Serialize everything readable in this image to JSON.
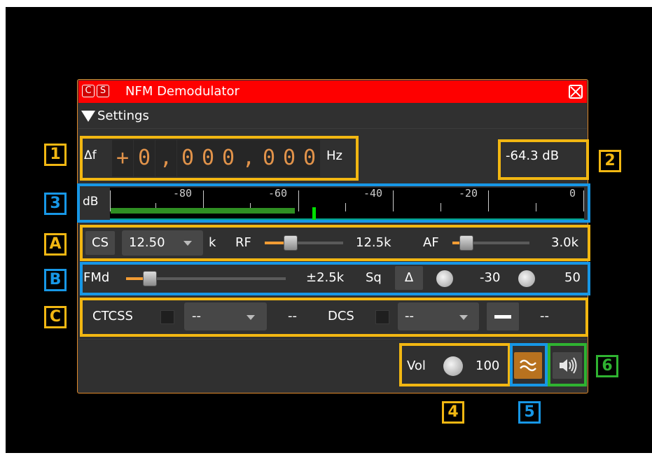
{
  "titlebar": {
    "c_label": "C",
    "s_label": "S",
    "title": "NFM Demodulator"
  },
  "settings": {
    "label": "Settings"
  },
  "frequency": {
    "delta_label": "Δf",
    "sign": "+",
    "digits": [
      "0",
      "0",
      "0",
      "0",
      "0",
      "0",
      "0"
    ],
    "separators": [
      ",",
      ","
    ],
    "unit": "Hz"
  },
  "power": {
    "value": "-64.3 dB"
  },
  "meter": {
    "unit": "dB",
    "tick_labels": [
      "-80",
      "-60",
      "-40",
      "-20",
      "0"
    ],
    "avg_level_db": -61,
    "peak_level_db": -57
  },
  "row_a": {
    "cs_label": "CS",
    "spacing_value": "12.50",
    "spacing_unit": "k",
    "rf_label": "RF",
    "rf_value": "12.5k",
    "af_label": "AF",
    "af_value": "3.0k"
  },
  "row_b": {
    "fmd_label": "FMd",
    "fmd_value": "±2.5k",
    "sq_label": "Sq",
    "delta_button": "Δ",
    "sq_threshold": "-30",
    "sq_gate": "50"
  },
  "row_c": {
    "ctcss_label": "CTCSS",
    "ctcss_select": "--",
    "ctcss_value": "--",
    "dcs_label": "DCS",
    "dcs_select": "--",
    "dcs_value": "--"
  },
  "bottom": {
    "vol_label": "Vol",
    "vol_value": "100"
  },
  "callouts": {
    "c1": "1",
    "c2": "2",
    "c3": "3",
    "cA": "A",
    "cB": "B",
    "cC": "C",
    "c4": "4",
    "c5": "5",
    "c6": "6"
  },
  "colors": {
    "accent": "#f39c34",
    "title_bar": "#fe0000",
    "highlight_yellow": "#f2b712",
    "highlight_blue": "#1797e6",
    "highlight_green": "#2fb331"
  }
}
